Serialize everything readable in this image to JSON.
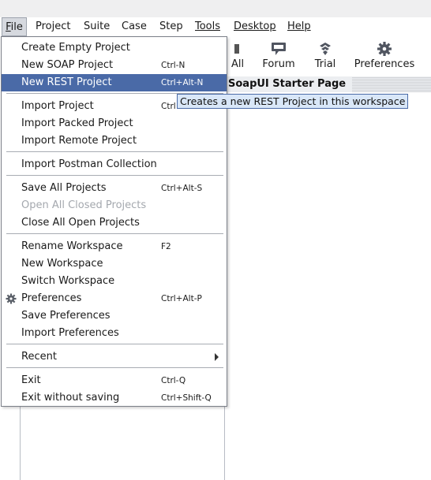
{
  "menubar": {
    "items": [
      "File",
      "Project",
      "Suite",
      "Case",
      "Step",
      "Tools",
      "Desktop",
      "Help"
    ]
  },
  "toolbar": {
    "buttons": [
      {
        "label": "All",
        "icon": "projects-icon"
      },
      {
        "label": "Forum",
        "icon": "forum-icon"
      },
      {
        "label": "Trial",
        "icon": "trial-icon"
      },
      {
        "label": "Preferences",
        "icon": "gear-icon"
      }
    ]
  },
  "tab": {
    "label": "SoapUI Starter Page"
  },
  "file_menu": {
    "create_empty_project": {
      "label": "Create Empty Project"
    },
    "new_soap_project": {
      "label": "New SOAP Project",
      "shortcut": "Ctrl-N"
    },
    "new_rest_project": {
      "label": "New REST Project",
      "shortcut": "Ctrl+Alt-N"
    },
    "import_project": {
      "label": "Import Project",
      "shortcut": "Ctrl"
    },
    "import_packed_project": {
      "label": "Import Packed Project"
    },
    "import_remote_project": {
      "label": "Import Remote Project"
    },
    "import_postman_collection": {
      "label": "Import Postman Collection"
    },
    "save_all_projects": {
      "label": "Save All Projects",
      "shortcut": "Ctrl+Alt-S"
    },
    "open_all_closed_projects": {
      "label": "Open All Closed Projects"
    },
    "close_all_open_projects": {
      "label": "Close All Open Projects"
    },
    "rename_workspace": {
      "label": "Rename Workspace",
      "shortcut": "F2"
    },
    "new_workspace": {
      "label": "New Workspace"
    },
    "switch_workspace": {
      "label": "Switch Workspace"
    },
    "preferences": {
      "label": "Preferences",
      "shortcut": "Ctrl+Alt-P"
    },
    "save_preferences": {
      "label": "Save Preferences"
    },
    "import_preferences": {
      "label": "Import Preferences"
    },
    "recent": {
      "label": "Recent"
    },
    "exit": {
      "label": "Exit",
      "shortcut": "Ctrl-Q"
    },
    "exit_without_saving": {
      "label": "Exit without saving",
      "shortcut": "Ctrl+Shift-Q"
    }
  },
  "tooltip": {
    "text": "Creates a new REST Project in this workspace"
  },
  "colors": {
    "highlight": "#4a6aa7",
    "tooltip_bg": "#d9e7f8",
    "disabled_text": "#a4a8ae"
  }
}
